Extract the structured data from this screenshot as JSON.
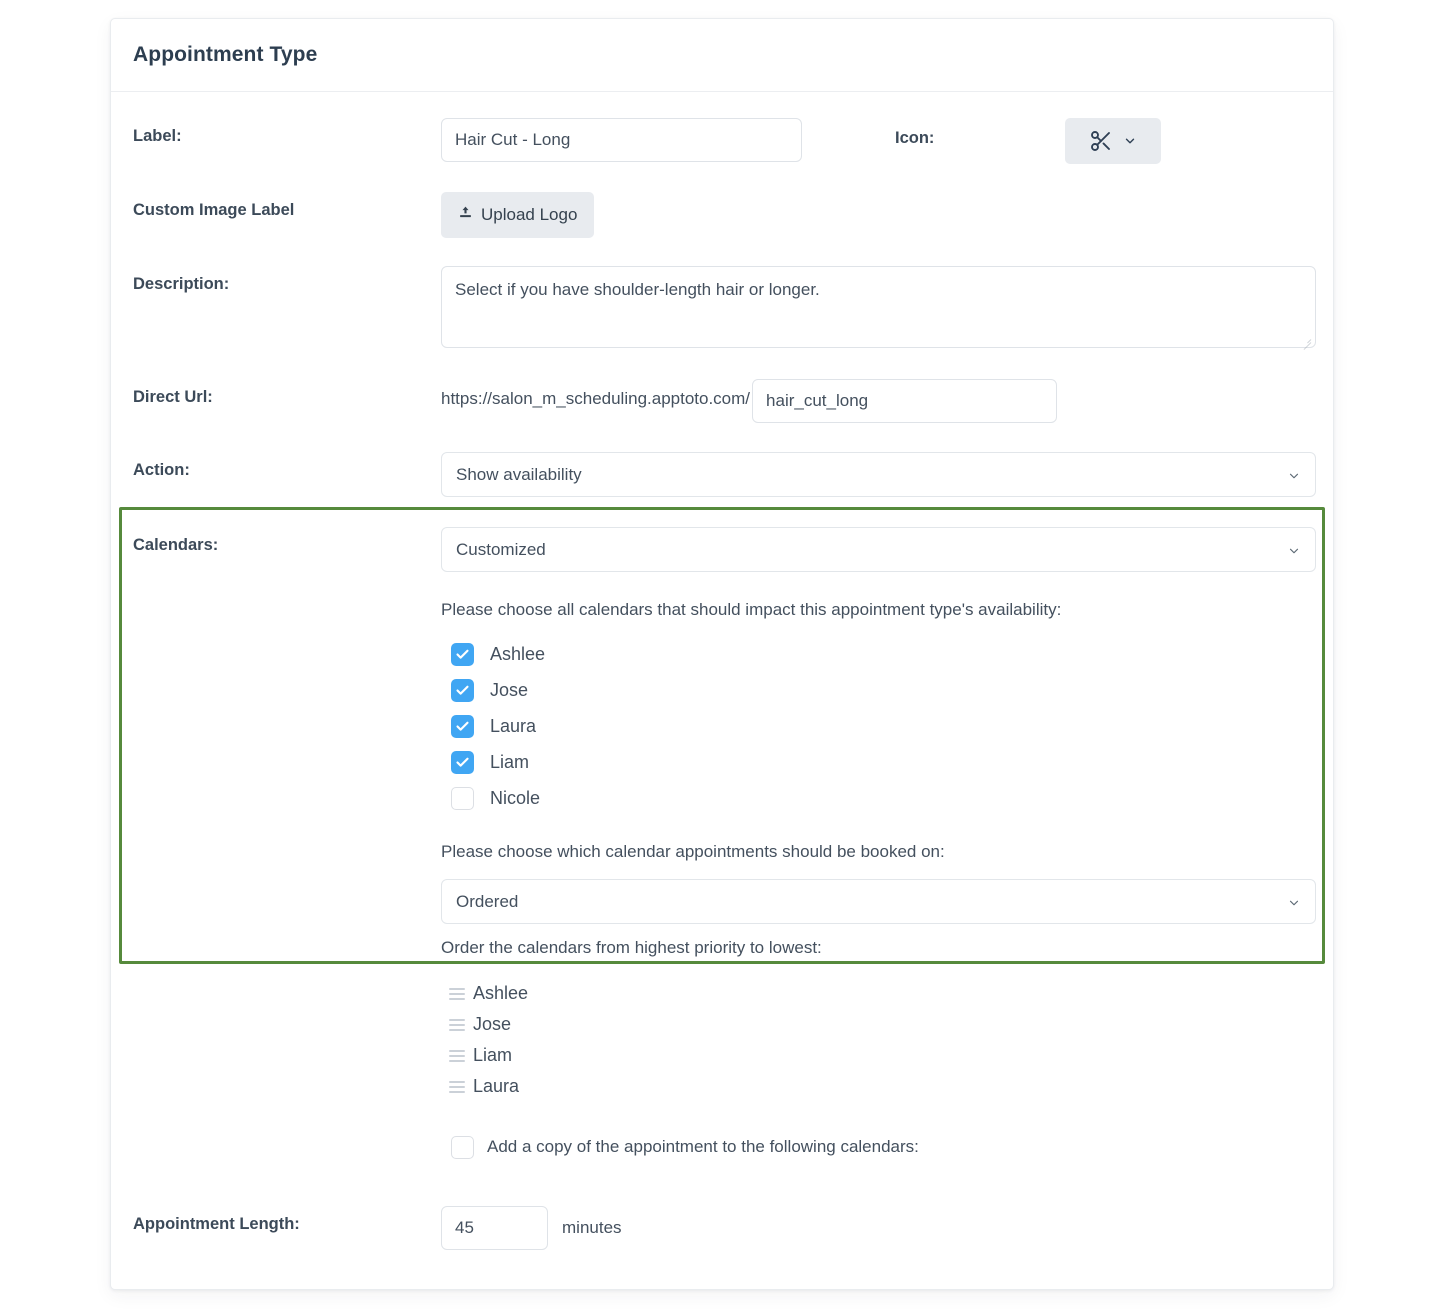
{
  "card": {
    "title": "Appointment Type"
  },
  "form": {
    "label_row": {
      "label": "Label:",
      "value": "Hair Cut - Long"
    },
    "icon_row": {
      "label": "Icon:",
      "icon": "scissors-icon",
      "chevron": "chevron-down-icon"
    },
    "custom_image_row": {
      "label": "Custom Image Label",
      "button": "Upload Logo",
      "button_icon": "upload-icon"
    },
    "description_row": {
      "label": "Description:",
      "value": "Select if you have shoulder-length hair or longer."
    },
    "direct_url_row": {
      "label": "Direct Url:",
      "prefix": "https://salon_m_scheduling.apptoto.com/",
      "value": "hair_cut_long"
    },
    "action_row": {
      "label": "Action:",
      "value": "Show availability"
    },
    "calendars_row": {
      "label": "Calendars:",
      "value": "Customized"
    },
    "appointment_length_row": {
      "label": "Appointment Length:",
      "value": "45",
      "unit": "minutes"
    }
  },
  "calendars_panel": {
    "impact_prompt": "Please choose all calendars that should impact this appointment type's availability:",
    "calendar_checkboxes": [
      {
        "name": "Ashlee",
        "checked": true
      },
      {
        "name": "Jose",
        "checked": true
      },
      {
        "name": "Laura",
        "checked": true
      },
      {
        "name": "Liam",
        "checked": true
      },
      {
        "name": "Nicole",
        "checked": false
      }
    ],
    "booked_on_prompt": "Please choose which calendar appointments should be booked on:",
    "booked_on_value": "Ordered",
    "order_prompt": "Order the calendars from highest priority to lowest:",
    "order_list": [
      "Ashlee",
      "Jose",
      "Liam",
      "Laura"
    ],
    "add_copy": {
      "label": "Add a copy of the appointment to the following calendars:",
      "checked": false
    },
    "highlight_color": "#568a3c"
  },
  "colors": {
    "accent_blue": "#40a6f3",
    "highlight_green": "#568a3c",
    "title_text": "#2d3e50",
    "body_text": "#44505e"
  }
}
